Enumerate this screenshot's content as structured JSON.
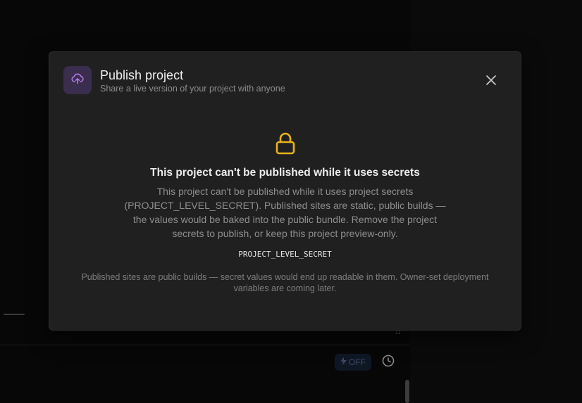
{
  "modal": {
    "title": "Publish project",
    "subtitle": "Share a live version of your project with anyone",
    "icon": "cloud-upload-icon",
    "close_icon": "close-icon"
  },
  "warning": {
    "icon": "lock-icon",
    "title": "This project can't be published while it uses secrets",
    "body": "This project can't be published while it uses project secrets (PROJECT_LEVEL_SECRET). Published sites are static, public builds — the values would be baked into the public bundle. Remove the project secrets to publish, or keep this project preview-only.",
    "secret_name": "PROJECT_LEVEL_SECRET",
    "footnote": "Published sites are public builds — secret values would end up readable in them. Owner-set deployment variables are coming later."
  },
  "background": {
    "fast_toggle_label": "OFF",
    "fast_toggle_icon": "lightning-icon",
    "history_icon": "clock-icon"
  },
  "colors": {
    "accent_purple": "#b07be8",
    "lock_yellow": "#e8b416",
    "modal_bg": "#202020"
  }
}
